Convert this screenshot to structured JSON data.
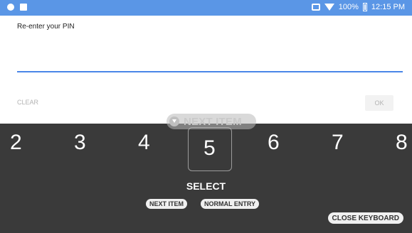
{
  "status_bar": {
    "battery": "100%",
    "time": "12:15 PM"
  },
  "dialog": {
    "title": "Re-enter your PIN",
    "clear_label": "CLEAR",
    "ok_label": "OK",
    "pin_value": ""
  },
  "overlay": {
    "next_item": "NEXT ITEM"
  },
  "keyboard": {
    "digits": [
      "2",
      "3",
      "4",
      "5",
      "6",
      "7",
      "8"
    ],
    "selected_digit": "5",
    "select_label": "SELECT",
    "chips": {
      "next_item": "NEXT ITEM",
      "normal_entry": "NORMAL ENTRY",
      "close_keyboard": "CLOSE KEYBOARD"
    }
  },
  "colors": {
    "status_bar": "#5a96e6",
    "keyboard_bg": "#3a3a3a",
    "accent_underline": "#4a86e8"
  }
}
